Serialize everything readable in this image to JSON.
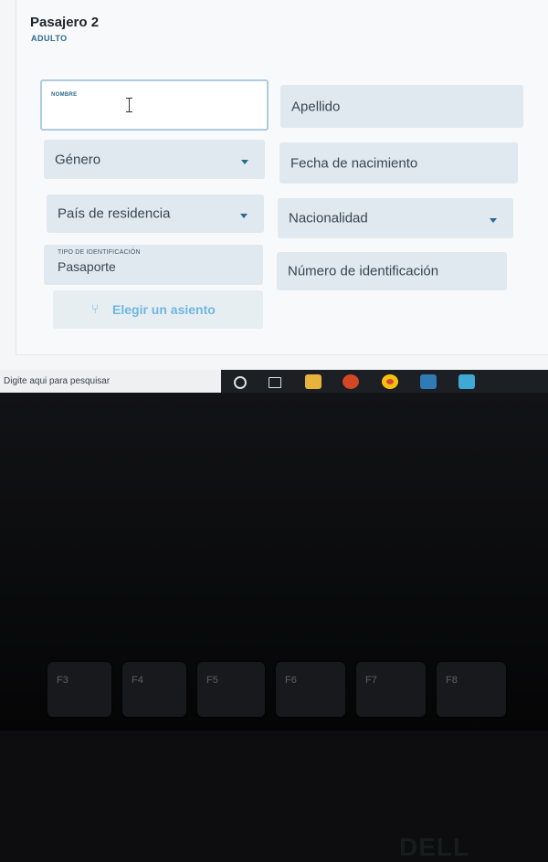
{
  "passenger": {
    "title": "Pasajero 2",
    "subtitle": "ADULTO"
  },
  "fields": {
    "nombre": {
      "label": "NOMBRE"
    },
    "apellido": {
      "placeholder": "Apellido"
    },
    "genero": {
      "placeholder": "Género"
    },
    "fecha": {
      "placeholder": "Fecha de nacimiento"
    },
    "pais": {
      "placeholder": "País de residencia"
    },
    "nacionalidad": {
      "placeholder": "Nacionalidad"
    },
    "tipo_id": {
      "label": "TIPO DE IDENTIFICACIÓN",
      "value": "Pasaporte"
    },
    "numero_id": {
      "placeholder": "Número de identificación"
    }
  },
  "seat_button": {
    "label": "Elegir un asiento",
    "icon": "seat-icon"
  },
  "taskbar": {
    "search_placeholder": "Digite aqui para pesquisar",
    "icons": [
      "search-circle-icon",
      "task-view-icon",
      "file-explorer-icon",
      "powerpoint-icon",
      "chrome-icon",
      "app-icon",
      "app-icon-2"
    ]
  },
  "laptop": {
    "brand": "DELL",
    "keys": [
      "F3",
      "F4",
      "F5",
      "F6",
      "F7",
      "F8"
    ]
  },
  "colors": {
    "accent": "#2b6a8e",
    "field_bg": "#dfe9ef",
    "button_text": "#6fb7e0"
  }
}
